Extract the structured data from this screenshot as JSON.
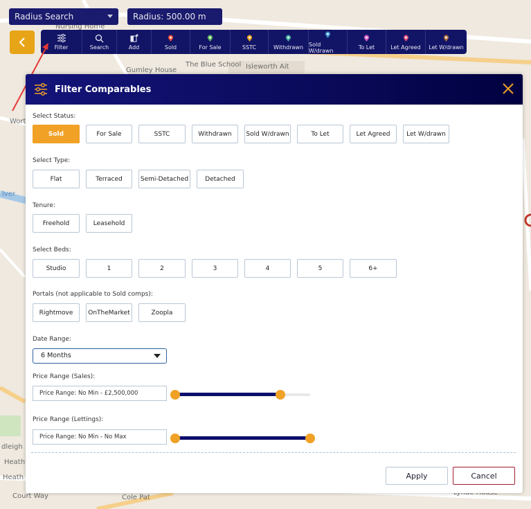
{
  "map": {
    "labels": [
      "Isleworth Ait",
      "Gumley House",
      "The Blue School",
      "Nursing Home",
      "Wort",
      "iver",
      "dleigh",
      "Heathf",
      "Heath",
      "Court Way",
      "Cole Pat",
      "Lynde House"
    ]
  },
  "top": {
    "radius_select": "Radius Search",
    "radius_value": "Radius: 500.00 m"
  },
  "toolbar": {
    "items": [
      {
        "label": "Filter",
        "icon": "filter-icon"
      },
      {
        "label": "Search",
        "icon": "search-icon"
      },
      {
        "label": "Add",
        "icon": "add-icon"
      },
      {
        "label": "Sold",
        "icon": "pin-icon",
        "color": "#e74c3c"
      },
      {
        "label": "For Sale",
        "icon": "pin-icon",
        "color": "#5cb85c"
      },
      {
        "label": "SSTC",
        "icon": "pin-icon",
        "color": "#e0a020"
      },
      {
        "label": "Withdrawn",
        "icon": "pin-icon",
        "color": "#3fae9a"
      },
      {
        "label": "Sold W/drawn",
        "icon": "pin-icon",
        "color": "#3a8fd0"
      },
      {
        "label": "To Let",
        "icon": "pin-icon",
        "color": "#d05ac0"
      },
      {
        "label": "Let Agreed",
        "icon": "pin-icon",
        "color": "#d94b7a"
      },
      {
        "label": "Let W/drawn",
        "icon": "pin-icon",
        "color": "#b07040"
      }
    ]
  },
  "modal": {
    "title": "Filter Comparables",
    "status": {
      "label": "Select Status:",
      "options": [
        "Sold",
        "For Sale",
        "SSTC",
        "Withdrawn",
        "Sold W/drawn",
        "To Let",
        "Let Agreed",
        "Let W/drawn"
      ],
      "selected": "Sold"
    },
    "type": {
      "label": "Select Type:",
      "options": [
        "Flat",
        "Terraced",
        "Semi-Detached",
        "Detached"
      ]
    },
    "tenure": {
      "label": "Tenure:",
      "options": [
        "Freehold",
        "Leasehold"
      ]
    },
    "beds": {
      "label": "Select Beds:",
      "options": [
        "Studio",
        "1",
        "2",
        "3",
        "4",
        "5",
        "6+"
      ]
    },
    "portals": {
      "label": "Portals (not applicable to Sold comps):",
      "options": [
        "Rightmove",
        "OnTheMarket",
        "Zoopla"
      ]
    },
    "date_range": {
      "label": "Date Range:",
      "value": "6 Months"
    },
    "price_sales": {
      "label": "Price Range (Sales):",
      "value": "Price Range: No Min - £2,500,000",
      "min_fraction": 0.0,
      "max_fraction": 0.78
    },
    "price_lettings": {
      "label": "Price Range (Lettings):",
      "value": "Price Range: No Min - No Max",
      "min_fraction": 0.0,
      "max_fraction": 1.0
    },
    "apply_label": "Apply",
    "cancel_label": "Cancel"
  },
  "colors": {
    "accent": "#f0a126",
    "navy": "#121566",
    "cancel_border": "#a01c2c"
  }
}
